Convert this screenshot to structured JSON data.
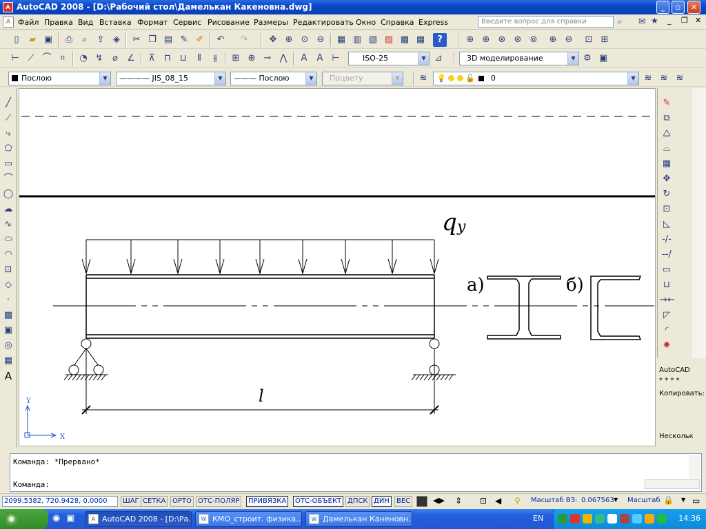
{
  "window": {
    "title": "AutoCAD 2008 - [D:\\Рабочий стол\\Дамелькан Какеновна.dwg]",
    "app_icon": "A"
  },
  "menu": {
    "items": [
      "Файл",
      "Правка",
      "Вид",
      "Вставка",
      "Формат",
      "Сервис",
      "Рисование",
      "Размеры",
      "Редактировать",
      "Окно",
      "Справка",
      "Express"
    ],
    "help_placeholder": "Введите вопрос для справки"
  },
  "toolbars": {
    "dimstyle": "ISO-25",
    "workspace": "3D моделирование",
    "color": "Послою",
    "linetype": "———— JIS_08_15",
    "lineweight": "——— Послою",
    "plotstyle": "Поцвету",
    "layer": "0"
  },
  "drawing": {
    "load_label": "q",
    "load_subscript": "y",
    "span_label": "l",
    "section_a_label": "а)",
    "section_b_label": "б)",
    "ucs_x": "X",
    "ucs_y": "Y"
  },
  "right_info": {
    "line1": "AutoCAD",
    "line2": "* * * *",
    "line3": "Копировать:",
    "line4": "Нескольк"
  },
  "command": {
    "line1": "Команда: *Прервано*",
    "line2": "Команда:"
  },
  "status": {
    "coords": "2099.5382, 720.9428, 0.0000",
    "buttons": [
      "ШАГ",
      "СЕТКА",
      "ОРТО",
      "ОТС-ПОЛЯР",
      "ПРИВЯЗКА",
      "ОТС-ОБЪЕКТ",
      "ДПСК",
      "ДИН",
      "ВЕС"
    ],
    "scale_label": "Масштаб ВЗ:",
    "scale_value": "0.067563",
    "scale_label2": "Масштаб"
  },
  "taskbar": {
    "start": "",
    "tasks": [
      "AutoCAD 2008 - [D:\\Ра...",
      "КМО_строит. физика...",
      "Дамелькан Каненовн..."
    ],
    "lang": "EN",
    "clock": "14:36"
  }
}
